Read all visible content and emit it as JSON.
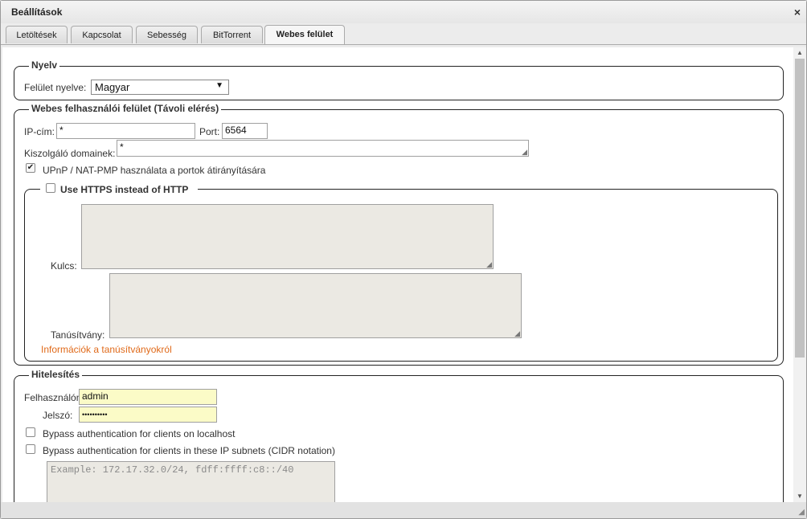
{
  "window": {
    "title": "Beállítások",
    "close_glyph": "×"
  },
  "tabs": [
    {
      "label": "Letöltések",
      "active": false
    },
    {
      "label": "Kapcsolat",
      "active": false
    },
    {
      "label": "Sebesség",
      "active": false
    },
    {
      "label": "BitTorrent",
      "active": false
    },
    {
      "label": "Webes felület",
      "active": true
    }
  ],
  "language": {
    "legend": "Nyelv",
    "label": "Felület nyelve:",
    "selected": "Magyar"
  },
  "webui": {
    "legend": "Webes felhasználói felület (Távoli elérés)",
    "ip_label": "IP-cím:",
    "ip_value": "*",
    "port_label": "Port:",
    "port_value": "6564",
    "domains_label": "Kiszolgáló domainek:",
    "domains_value": "*",
    "upnp_label": "UPnP / NAT-PMP használata a portok átirányítására",
    "upnp_checked": true,
    "https": {
      "legend": "Use HTTPS instead of HTTP",
      "checked": false,
      "key_label": "Kulcs:",
      "cert_label": "Tanúsítvány:",
      "info_link": "Információk a tanúsítványokról"
    }
  },
  "auth": {
    "legend": "Hitelesítés",
    "username_label": "Felhasználónév:",
    "username_value": "admin",
    "password_label": "Jelszó:",
    "password_value": "••••••••••",
    "bypass_localhost_label": "Bypass authentication for clients on localhost",
    "bypass_subnets_label": "Bypass authentication for clients in these IP subnets (CIDR notation)",
    "subnets_placeholder": "Example: 172.17.32.0/24, fdff:ffff:c8::/40"
  },
  "colors": {
    "link": "#e06a1a",
    "autofill": "#fbfbc7"
  }
}
